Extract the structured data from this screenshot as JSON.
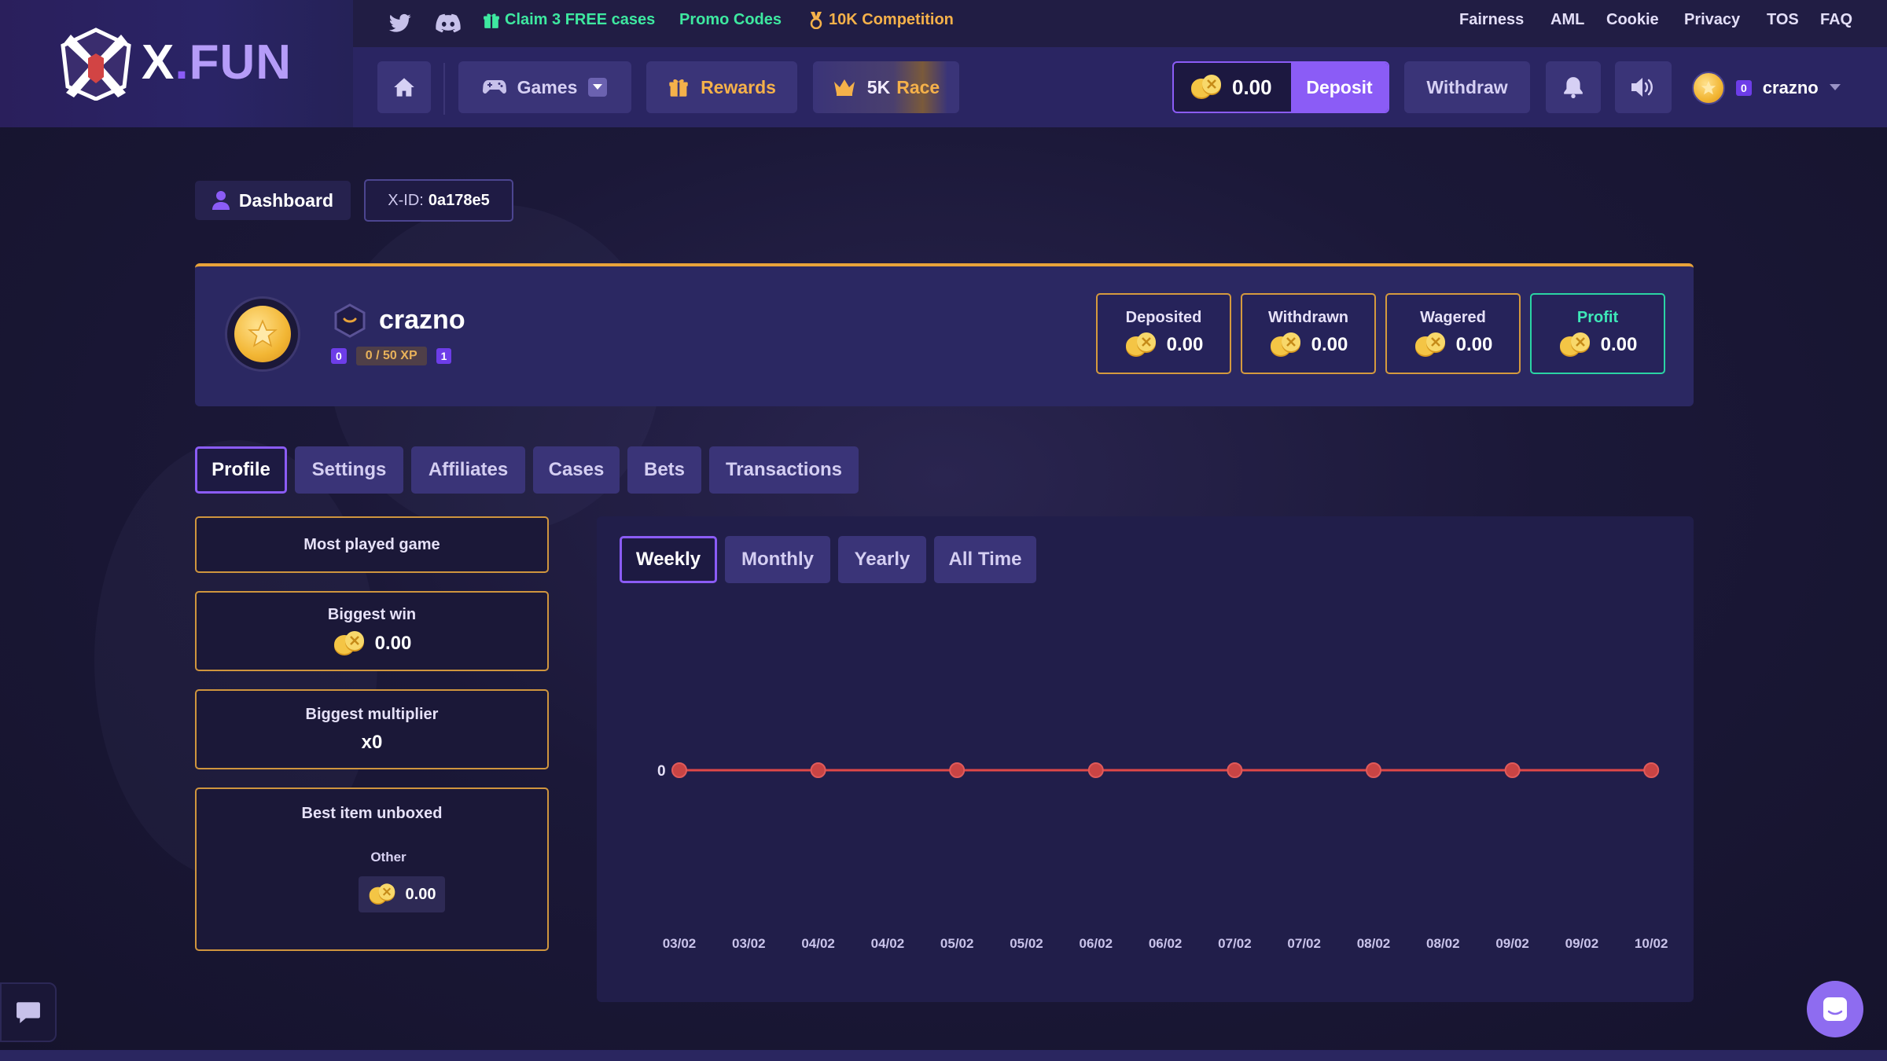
{
  "brand": {
    "logo_x": "X",
    "logo_dot": ".",
    "logo_fun": "FUN"
  },
  "topstrip": {
    "social": [
      "twitter-icon",
      "discord-icon"
    ],
    "claim_cases": "Claim 3 FREE cases",
    "promo_codes": "Promo Codes",
    "competition": "10K Competition",
    "links": [
      "Fairness",
      "AML",
      "Cookie",
      "Privacy",
      "TOS",
      "FAQ"
    ]
  },
  "navbar": {
    "games": "Games",
    "rewards": "Rewards",
    "race_prefix": "5K",
    "race_suffix": "Race",
    "balance": "0.00",
    "deposit": "Deposit",
    "withdraw": "Withdraw",
    "user_level": "0",
    "username": "crazno"
  },
  "header_tags": {
    "dashboard": "Dashboard",
    "xid_label": "X-ID:",
    "xid_value": "0a178e5"
  },
  "profile": {
    "username": "crazno",
    "level_current": "0",
    "xp": "0 / 50 XP",
    "level_next": "1",
    "stats": [
      {
        "label": "Deposited",
        "value": "0.00"
      },
      {
        "label": "Withdrawn",
        "value": "0.00"
      },
      {
        "label": "Wagered",
        "value": "0.00"
      },
      {
        "label": "Profit",
        "value": "0.00"
      }
    ]
  },
  "tabs": [
    "Profile",
    "Settings",
    "Affiliates",
    "Cases",
    "Bets",
    "Transactions"
  ],
  "active_tab": "Profile",
  "panels": {
    "most_played": "Most played game",
    "biggest_win_title": "Biggest win",
    "biggest_win_value": "0.00",
    "biggest_multiplier_title": "Biggest multiplier",
    "biggest_multiplier_value": "x0",
    "best_item_title": "Best item unboxed",
    "best_item_name": "Other",
    "best_item_value": "0.00"
  },
  "period_tabs": [
    "Weekly",
    "Monthly",
    "Yearly",
    "All Time"
  ],
  "active_period": "Weekly",
  "chart_data": {
    "type": "line",
    "x": [
      "03/02",
      "03/02",
      "04/02",
      "04/02",
      "05/02",
      "05/02",
      "06/02",
      "06/02",
      "07/02",
      "07/02",
      "08/02",
      "08/02",
      "09/02",
      "09/02",
      "10/02"
    ],
    "series": [
      {
        "values": [
          0,
          0,
          0,
          0,
          0,
          0,
          0,
          0
        ]
      }
    ],
    "y_ticks": [
      "0"
    ],
    "line_color": "#e04848",
    "grid": false
  },
  "colors": {
    "accent": "#8b5cf6",
    "gold": "#e8a33a",
    "profit": "#2bd4a4",
    "promo_green": "#3ee8a0",
    "competition_gold": "#f5b14a"
  }
}
